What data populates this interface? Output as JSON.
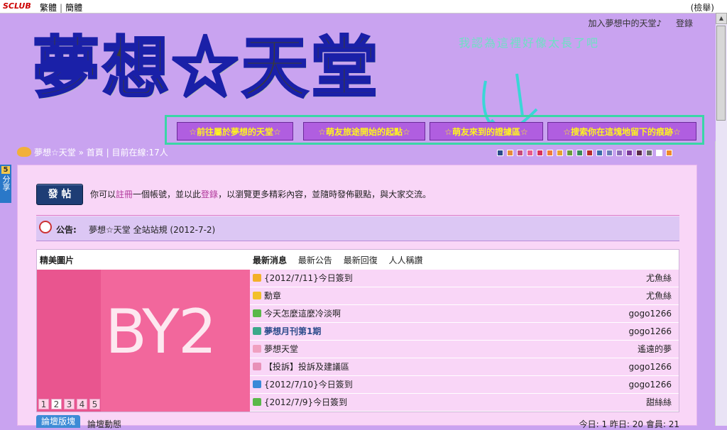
{
  "sysbar": {
    "logo": "SCLUB",
    "lang_traditional": "繁體",
    "lang_simplified": "簡體",
    "report": "(檢舉)"
  },
  "header": {
    "join_link": "加入夢想中的天堂♪",
    "login_link": "登錄",
    "logo_text": "夢想☆天堂",
    "slogan": "我認為這裡好像太長了吧",
    "nav": [
      {
        "label": "☆前往屬於夢想的天堂☆"
      },
      {
        "label": "☆萌友旅途開始的起點☆"
      },
      {
        "label": "☆萌友來到的證據區☆"
      },
      {
        "label": "☆搜索你在這塊地留下的痕跡☆"
      }
    ]
  },
  "breadcrumb": {
    "site": "夢想☆天堂",
    "sep": "»",
    "home": "首頁",
    "online": "目前在線:17人"
  },
  "theme_colors": [
    "#2a4a8a",
    "#e68a3a",
    "#c94a7a",
    "#e85a8a",
    "#d8305a",
    "#f07a3a",
    "#e8a030",
    "#6a9a3a",
    "#3a8a5a",
    "#b82a2a",
    "#3a6aa8",
    "#6a7ab8",
    "#8a6ab8",
    "#7a3a9a",
    "#5a2a4a",
    "#6a6a6a",
    "#ffffff",
    "#f08a2a"
  ],
  "share_tab": {
    "badge": "5",
    "label": "分享"
  },
  "main": {
    "post_button": "發 帖",
    "intro_prefix": "你可以",
    "intro_register": "註冊",
    "intro_mid": "一個帳號，並以此",
    "intro_login": "登錄",
    "intro_suffix": "，以瀏覽更多精彩內容，並隨時發佈觀點，與大家交流。",
    "notice_label": "公告:",
    "notice_text": "夢想☆天堂 全站站規 (2012-7-2)",
    "pic_title": "精美圖片",
    "pic_text": "BY2",
    "pager": [
      "1",
      "2",
      "3",
      "4",
      "5"
    ],
    "news_tabs": [
      "最新消息",
      "最新公告",
      "最新回復",
      "人人稱讚"
    ],
    "news": [
      {
        "title": "{2012/7/11}今日簽到",
        "author": "尤魚絲",
        "icon_color": "#f2b02a",
        "bold": false
      },
      {
        "title": "勳章",
        "author": "尤魚絲",
        "icon_color": "#f2c02a",
        "bold": false
      },
      {
        "title": "今天怎麼這麼冷淡啊",
        "author": "gogo1266",
        "icon_color": "#5ab84a",
        "bold": false
      },
      {
        "title": "夢想月刊第1期",
        "author": "gogo1266",
        "icon_color": "#3aa88a",
        "bold": true
      },
      {
        "title": "夢想天堂",
        "author": "遙遠的夢",
        "icon_color": "#f0a0c0",
        "bold": false
      },
      {
        "title": "【投訴】投訴及建議區",
        "author": "gogo1266",
        "icon_color": "#e890b8",
        "bold": false
      },
      {
        "title": "{2012/7/10}今日簽到",
        "author": "gogo1266",
        "icon_color": "#3a8ad8",
        "bold": false
      },
      {
        "title": "{2012/7/9}今日簽到",
        "author": "甜絲絲",
        "icon_color": "#5ab84a",
        "bold": false
      }
    ],
    "bottom_tab": "論壇版塊",
    "bottom_link": "論壇動態",
    "stats": "今日: 1  昨日: 20  會員: 21"
  }
}
